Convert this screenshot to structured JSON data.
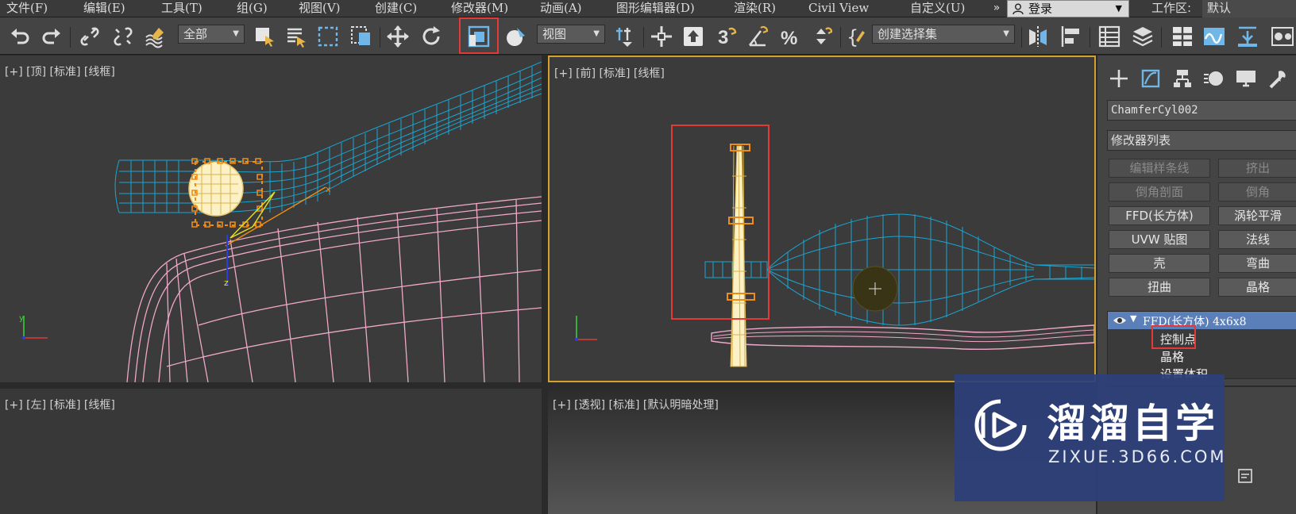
{
  "menubar": {
    "items": [
      "文件(F)",
      "编辑(E)",
      "工具(T)",
      "组(G)",
      "视图(V)",
      "创建(C)",
      "修改器(M)",
      "动画(A)",
      "图形编辑器(D)",
      "渲染(R)",
      "Civil View",
      "自定义(U)"
    ],
    "more": "»",
    "login": "登录",
    "workspace_label": "工作区:",
    "workspace_value": "默认"
  },
  "toolbar": {
    "selection_filter": "全部",
    "ref_coord": "视图",
    "named_selection": "创建选择集",
    "snap_label": "3",
    "highlighted_tool": "select-and-squash-icon"
  },
  "viewports": {
    "top": "[+] [顶] [标准] [线框]",
    "front": "[+] [前] [标准] [线框]",
    "left": "[+] [左] [标准] [线框]",
    "perspective": "[+] [透视] [标准] [默认明暗处理]",
    "gizmo_x": "x",
    "gizmo_y": "y",
    "gizmo_z": "z"
  },
  "command_panel": {
    "object_name": "ChamferCyl002",
    "modifier_list": "修改器列表",
    "buttons": [
      {
        "label": "编辑样条线",
        "enabled": false
      },
      {
        "label": "挤出",
        "enabled": false
      },
      {
        "label": "倒角剖面",
        "enabled": false
      },
      {
        "label": "倒角",
        "enabled": false
      },
      {
        "label": "FFD(长方体)",
        "enabled": true
      },
      {
        "label": "涡轮平滑",
        "enabled": true
      },
      {
        "label": "UVW 贴图",
        "enabled": true
      },
      {
        "label": "法线",
        "enabled": true
      },
      {
        "label": "壳",
        "enabled": true
      },
      {
        "label": "弯曲",
        "enabled": true
      },
      {
        "label": "扭曲",
        "enabled": true
      },
      {
        "label": "晶格",
        "enabled": true
      }
    ],
    "stack": {
      "modifier": "FFD(长方体) 4x6x8",
      "sub_objects": [
        "控制点",
        "晶格",
        "设置体积"
      ]
    }
  },
  "watermark": {
    "title": "溜溜自学",
    "subtitle": "ZIXUE.3D66.COM"
  },
  "colors": {
    "highlight": "#e53935",
    "active_viewport_border": "#d4a22c",
    "wire_blue": "#1aa6d2",
    "wire_pink": "#f0a8c8",
    "selected_object": "#f5e6a8",
    "stack_selection": "#5b7fb8"
  }
}
